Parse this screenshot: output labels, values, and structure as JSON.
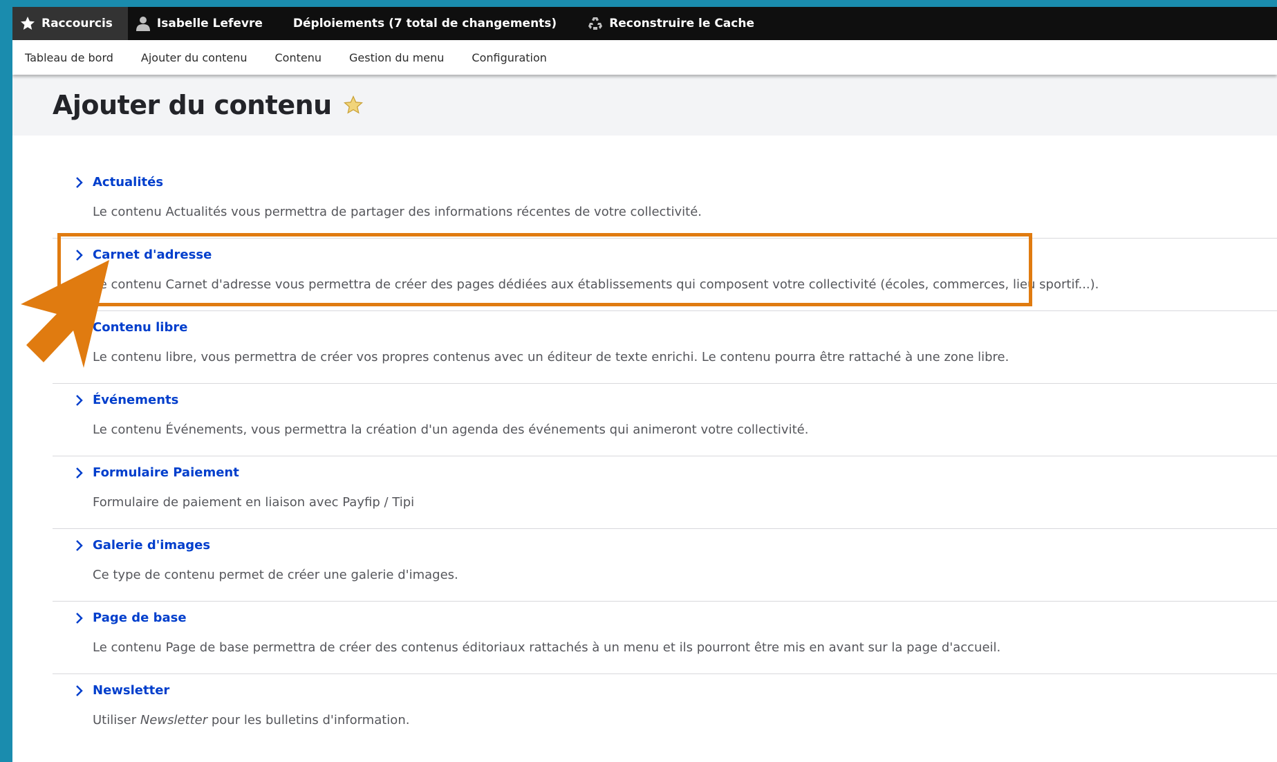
{
  "toolbar": {
    "shortcuts_label": "Raccourcis",
    "user_label": "Isabelle Lefevre",
    "deployments_label": "Déploiements (7 total de changements)",
    "rebuild_cache_label": "Reconstruire le Cache"
  },
  "menu": {
    "dashboard": "Tableau de bord",
    "add_content": "Ajouter du contenu",
    "content": "Contenu",
    "menu_management": "Gestion du menu",
    "configuration": "Configuration"
  },
  "page": {
    "title": "Ajouter du contenu"
  },
  "content_types": [
    {
      "title": "Actualités",
      "description": "Le contenu Actualités vous permettra de partager des informations récentes de votre collectivité."
    },
    {
      "title": "Carnet d'adresse",
      "description": "Le contenu Carnet d'adresse vous permettra de créer des pages dédiées aux établissements qui composent votre collectivité (écoles, commerces, lieu sportif...)."
    },
    {
      "title": "Contenu libre",
      "description": "Le contenu libre, vous permettra de créer vos propres contenus avec un éditeur de texte enrichi. Le contenu pourra être rattaché à une zone libre."
    },
    {
      "title": "Événements",
      "description": "Le contenu Événements, vous permettra la création d'un agenda des événements qui animeront votre collectivité."
    },
    {
      "title": "Formulaire Paiement",
      "description": "Formulaire de paiement en liaison avec Payfip / Tipi"
    },
    {
      "title": "Galerie d'images",
      "description": "Ce type de contenu permet de créer une galerie d'images."
    },
    {
      "title": "Page de base",
      "description": "Le contenu Page de base permettra de créer des contenus éditoriaux rattachés à un menu et ils pourront être mis en avant sur la page d'accueil."
    },
    {
      "title": "Newsletter",
      "description_prefix": "Utiliser ",
      "description_em": "Newsletter",
      "description_suffix": " pour les bulletins d'information."
    }
  ],
  "colors": {
    "accent": "#e07b10",
    "link": "#003ecc",
    "toolbar_bg": "#0f0f0f",
    "star": "#e8c24a"
  }
}
